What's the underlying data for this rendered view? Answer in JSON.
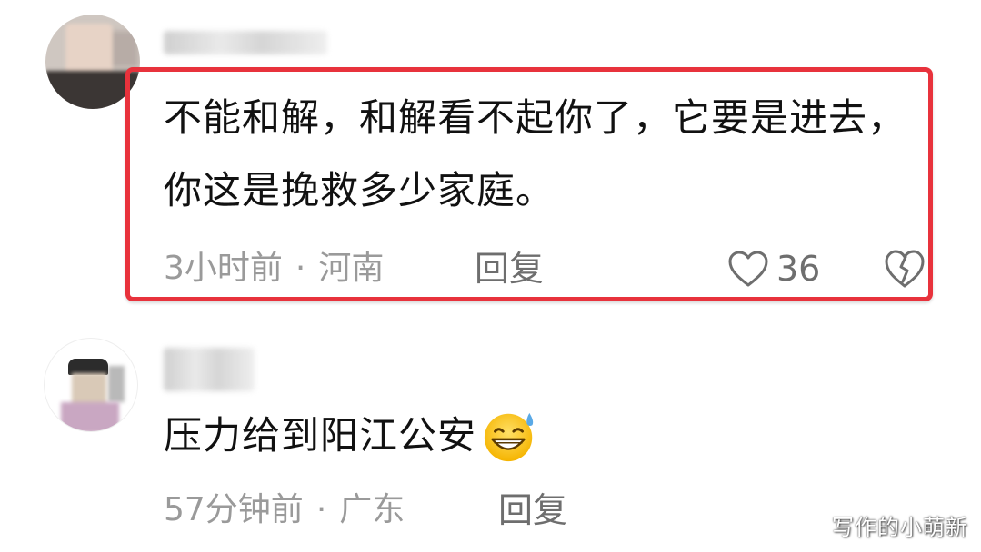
{
  "comments": [
    {
      "text": "不能和解，和解看不起你了，它要是进去，你这是挽救多少家庭。",
      "time": "3小时前",
      "separator": "·",
      "location": "河南",
      "reply_label": "回复",
      "likes": "36",
      "highlighted": true,
      "highlight_color": "#e8323c"
    },
    {
      "text": "压力给到阳江公安",
      "emoji": "grinning-sweat-emoji",
      "time": "57分钟前",
      "separator": "·",
      "location": "广东",
      "reply_label": "回复"
    }
  ],
  "watermark": "写作的小萌新",
  "colors": {
    "meta_text": "#9a9a9a",
    "body_text": "#111111",
    "highlight": "#e8323c"
  }
}
